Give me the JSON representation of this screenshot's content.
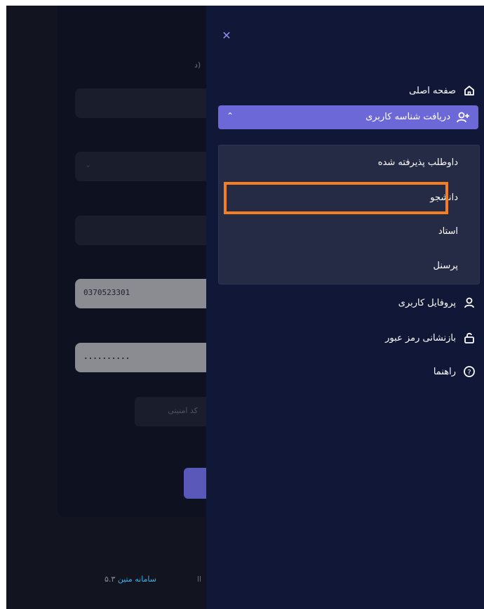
{
  "form": {
    "partial_text": "د)",
    "national_code_value": "0370523301",
    "password_value": "..........",
    "captcha_placeholder": "کد امنیتی"
  },
  "footer": {
    "brand": "سامانه متین",
    "version": "۵.۳",
    "separator": "ll"
  },
  "menu": {
    "home_label": "صفحه اصلی",
    "get_user_id_label": "دریافت شناسه کاربری",
    "submenu": [
      {
        "label": "داوطلب پذیرفته شده"
      },
      {
        "label": "دانشجو"
      },
      {
        "label": "استاد"
      },
      {
        "label": "پرسنل"
      }
    ],
    "profile_label": "پروفایل کاربری",
    "reset_password_label": "بازنشانی رمز عبور",
    "help_label": "راهنما"
  },
  "colors": {
    "accent": "#6c68d8",
    "highlight": "#f57f20",
    "panel_bg": "#111736"
  }
}
